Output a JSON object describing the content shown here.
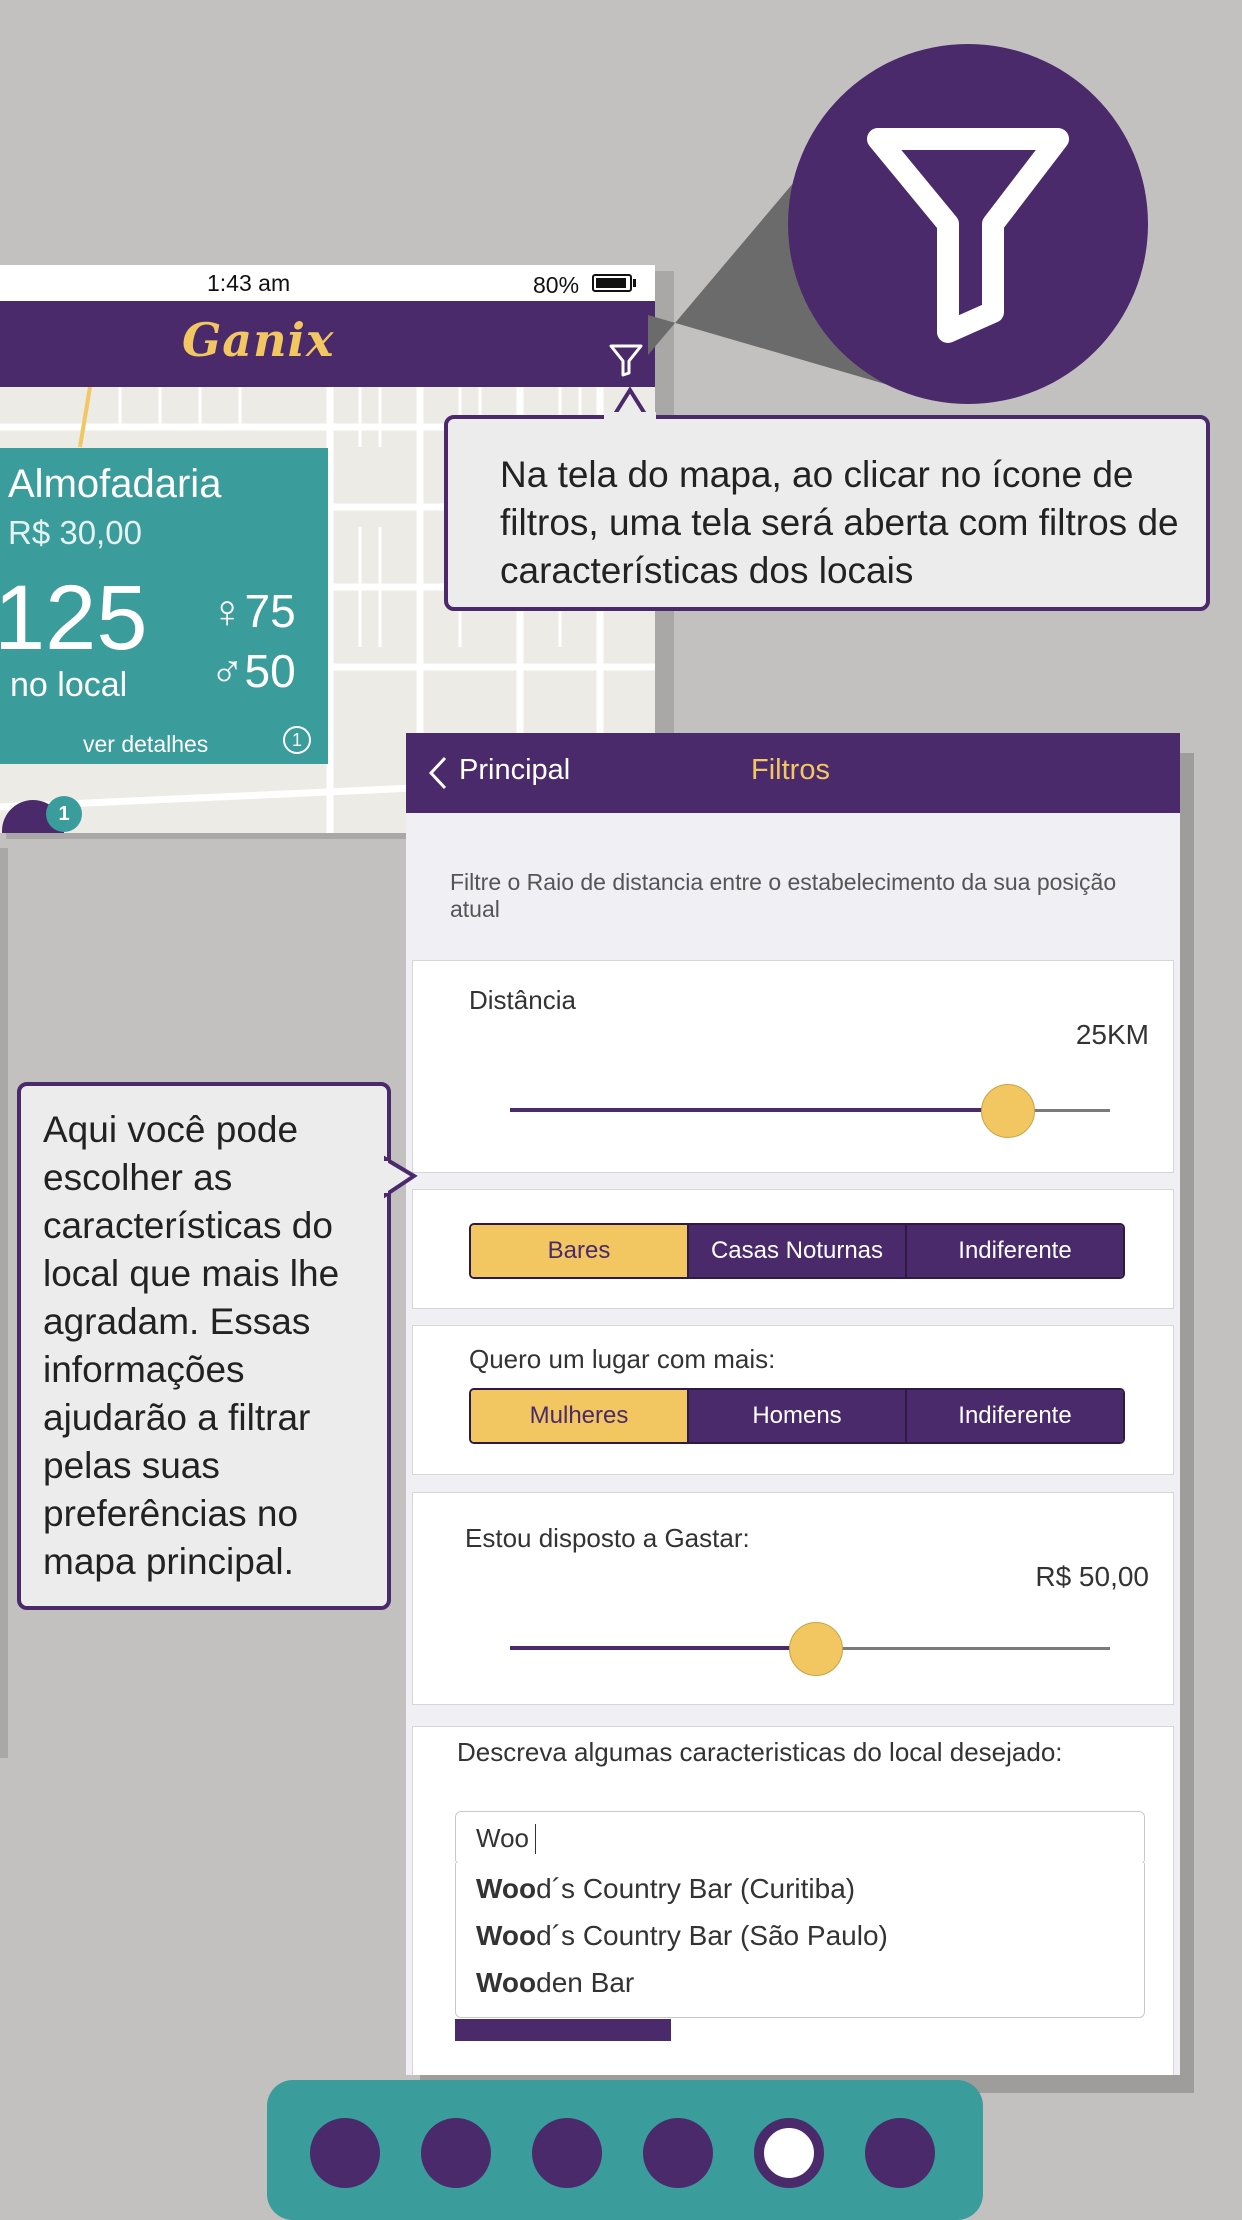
{
  "status_bar": {
    "time": "1:43 am",
    "battery": "80%"
  },
  "map_screen": {
    "logo": "Ganix",
    "filter_icon": "filter-icon",
    "venue_card": {
      "name": "Almofadaria",
      "price": "R$ 30,00",
      "count": "125",
      "count_label": "no local",
      "female": "♀75",
      "male": "♂50",
      "details_link": "ver detalhes",
      "info_badge": "1"
    },
    "pin_badge": "1"
  },
  "callouts": {
    "filter_hint": "Na tela do mapa, ao clicar no ícone de filtros, uma tela será aberta com filtros de características dos locais",
    "characteristics_hint": "Aqui você pode escolher as características do local que mais lhe agradam. Essas informações ajudarão a filtrar pelas suas preferências no mapa principal."
  },
  "filters_screen": {
    "back_label": "Principal",
    "title": "Filtros",
    "hint": "Filtre o Raio de distancia entre o estabelecimento da sua posição atual",
    "distance": {
      "label": "Distância",
      "value_text": "25KM",
      "level": 0.83
    },
    "venue_type": {
      "options": [
        "Bares",
        "Casas Noturnas",
        "Indiferente"
      ],
      "selected": "Bares"
    },
    "crowd": {
      "label": "Quero um lugar com mais:",
      "options": [
        "Mulheres",
        "Homens",
        "Indiferente"
      ],
      "selected": "Mulheres"
    },
    "spend": {
      "label": "Estou disposto a Gastar:",
      "value_text": "R$ 50,00",
      "level": 0.51
    },
    "describe": {
      "label": "Descreva algumas caracteristicas do local desejado:",
      "input_value": "Woo",
      "suggestions": [
        {
          "match": "Woo",
          "rest": "d´s Country Bar (Curitiba)"
        },
        {
          "match": "Woo",
          "rest": "d´s Country Bar (São Paulo)"
        },
        {
          "match": "Woo",
          "rest": "den Bar"
        }
      ]
    }
  },
  "pager": {
    "count": 6,
    "active_index": 4
  },
  "colors": {
    "purple": "#4a2a6b",
    "teal": "#3b9c9c",
    "yellow": "#f2c661",
    "background": "#c2c1c0"
  }
}
